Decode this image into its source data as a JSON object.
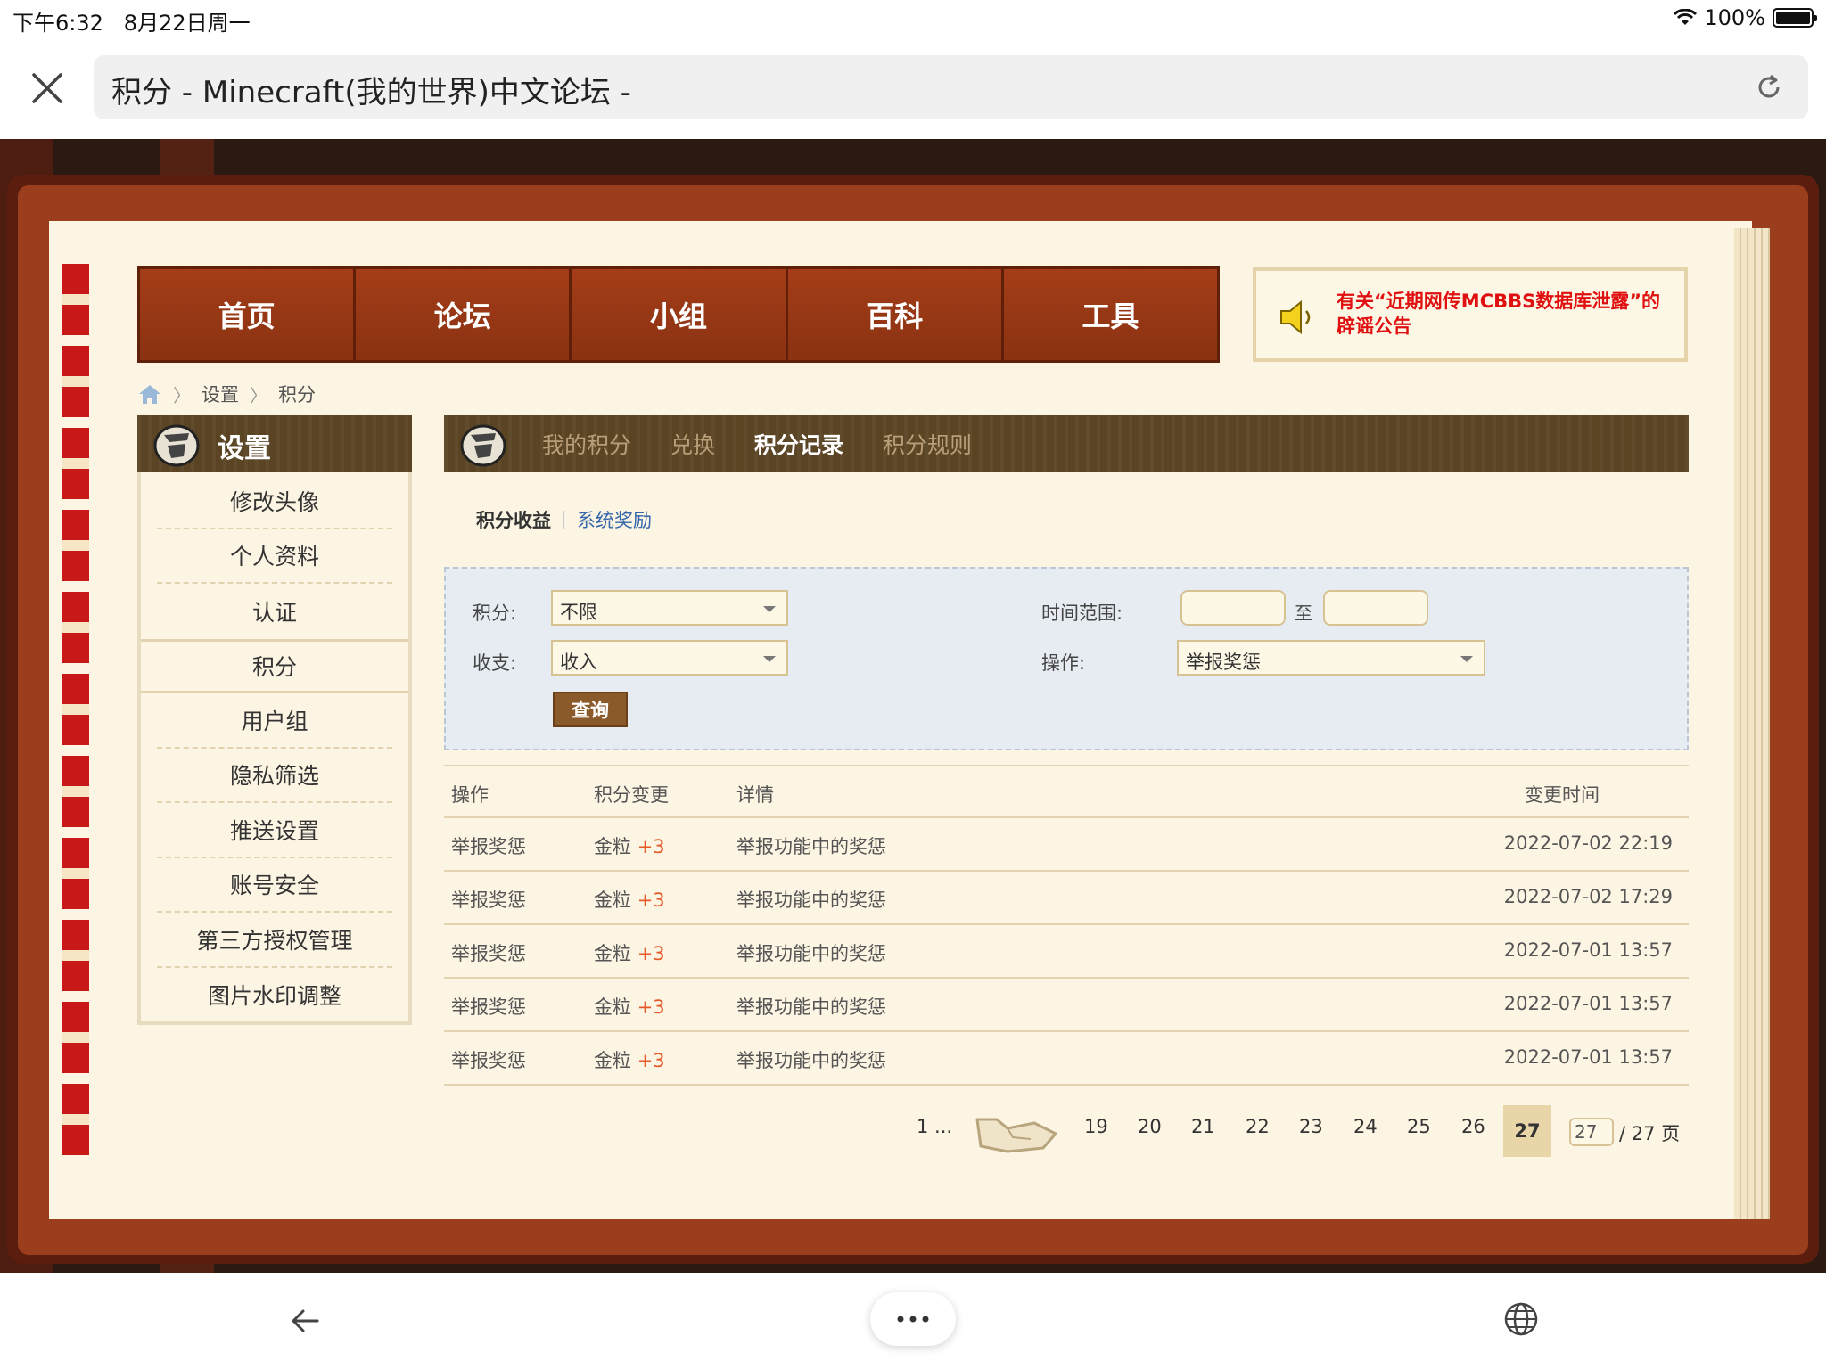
{
  "status_bar": {
    "time": "下午6:32",
    "date": "8月22日周一",
    "battery": "100%"
  },
  "browser": {
    "url_title": "积分 - Minecraft(我的世界)中文论坛 -"
  },
  "nav": {
    "items": [
      "首页",
      "论坛",
      "小组",
      "百科",
      "工具"
    ]
  },
  "notice": {
    "text": "有关“近期网传MCBBS数据库泄露”的辟谣公告",
    "color": "#e01010"
  },
  "breadcrumb": {
    "items": [
      "设置",
      "积分"
    ]
  },
  "sidebar": {
    "title": "设置",
    "items": [
      "修改头像",
      "个人资料",
      "认证",
      "积分",
      "用户组",
      "隐私筛选",
      "推送设置",
      "账号安全",
      "第三方授权管理",
      "图片水印调整"
    ],
    "active_index": 3
  },
  "main_tabs": {
    "items": [
      "我的积分",
      "兑换",
      "积分记录",
      "积分规则"
    ],
    "active_index": 2
  },
  "sub_tabs": {
    "items": [
      "积分收益",
      "系统奖励"
    ],
    "active_index": 0
  },
  "filter": {
    "credit_label": "积分:",
    "credit_value": "不限",
    "income_label": "收支:",
    "income_value": "收入",
    "time_label": "时间范围:",
    "to_label": "至",
    "op_label": "操作:",
    "op_value": "举报奖惩",
    "query_button": "查询"
  },
  "table": {
    "headers": [
      "操作",
      "积分变更",
      "详情",
      "变更时间"
    ],
    "rows": [
      {
        "op": "举报奖惩",
        "credit": "金粒",
        "delta": "+3",
        "detail": "举报功能中的奖惩",
        "time": "2022-07-02 22:19"
      },
      {
        "op": "举报奖惩",
        "credit": "金粒",
        "delta": "+3",
        "detail": "举报功能中的奖惩",
        "time": "2022-07-02 17:29"
      },
      {
        "op": "举报奖惩",
        "credit": "金粒",
        "delta": "+3",
        "detail": "举报功能中的奖惩",
        "time": "2022-07-01 13:57"
      },
      {
        "op": "举报奖惩",
        "credit": "金粒",
        "delta": "+3",
        "detail": "举报功能中的奖惩",
        "time": "2022-07-01 13:57"
      },
      {
        "op": "举报奖惩",
        "credit": "金粒",
        "delta": "+3",
        "detail": "举报功能中的奖惩",
        "time": "2022-07-01 13:57"
      }
    ]
  },
  "pagination": {
    "first": "1 ...",
    "pages": [
      "19",
      "20",
      "21",
      "22",
      "23",
      "24",
      "25",
      "26"
    ],
    "current": "27",
    "input_value": "27",
    "total": "/ 27 页"
  }
}
